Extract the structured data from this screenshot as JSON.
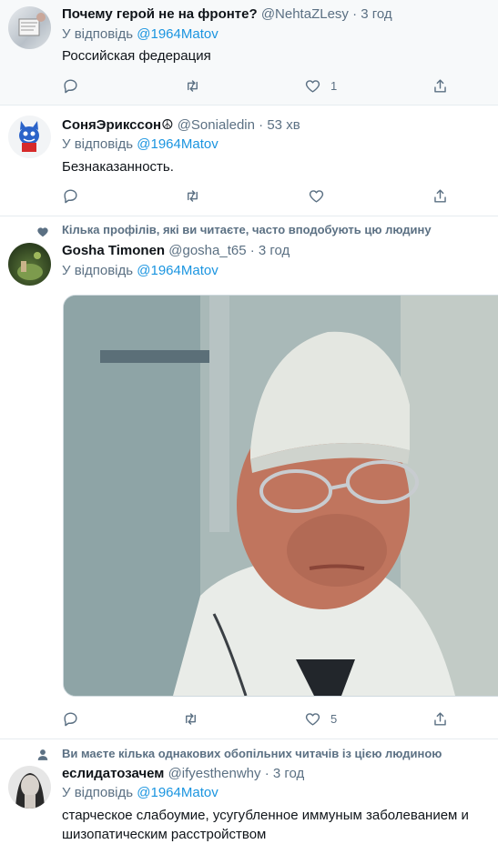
{
  "tweets": [
    {
      "name": "Почему герой не на фронте?",
      "handle": "@NehtaZLesy",
      "time": "3 год",
      "reply_prefix": "У відповідь",
      "reply_to": "@1964Matov",
      "text": "Российская федерация",
      "likes": "1"
    },
    {
      "name": "СоняЭрикссон☮",
      "handle": "@Sonialedin",
      "time": "53 хв",
      "reply_prefix": "У відповідь",
      "reply_to": "@1964Matov",
      "text": "Безнаказанность."
    },
    {
      "social_context": "Кілька профілів, які ви читаєте, часто вподобують цю людину",
      "name": "Gosha Timonen",
      "handle": "@gosha_t65",
      "time": "3 год",
      "reply_prefix": "У відповідь",
      "reply_to": "@1964Matov",
      "likes": "5"
    },
    {
      "social_context": "Ви маєте кілька однакових обопільних читачів із цією людиною",
      "name": "еслидатозачем",
      "handle": "@ifyesthenwhy",
      "time": "3 год",
      "reply_prefix": "У відповідь",
      "reply_to": "@1964Matov",
      "text": "старческое слабоумие, усугубленное иммуным заболеванием и шизопатическим расстройством"
    }
  ],
  "separator": "·",
  "colors": {
    "link": "#1b95e0",
    "muted": "#5b7083",
    "highlight_bg": "#f7f9fa"
  }
}
